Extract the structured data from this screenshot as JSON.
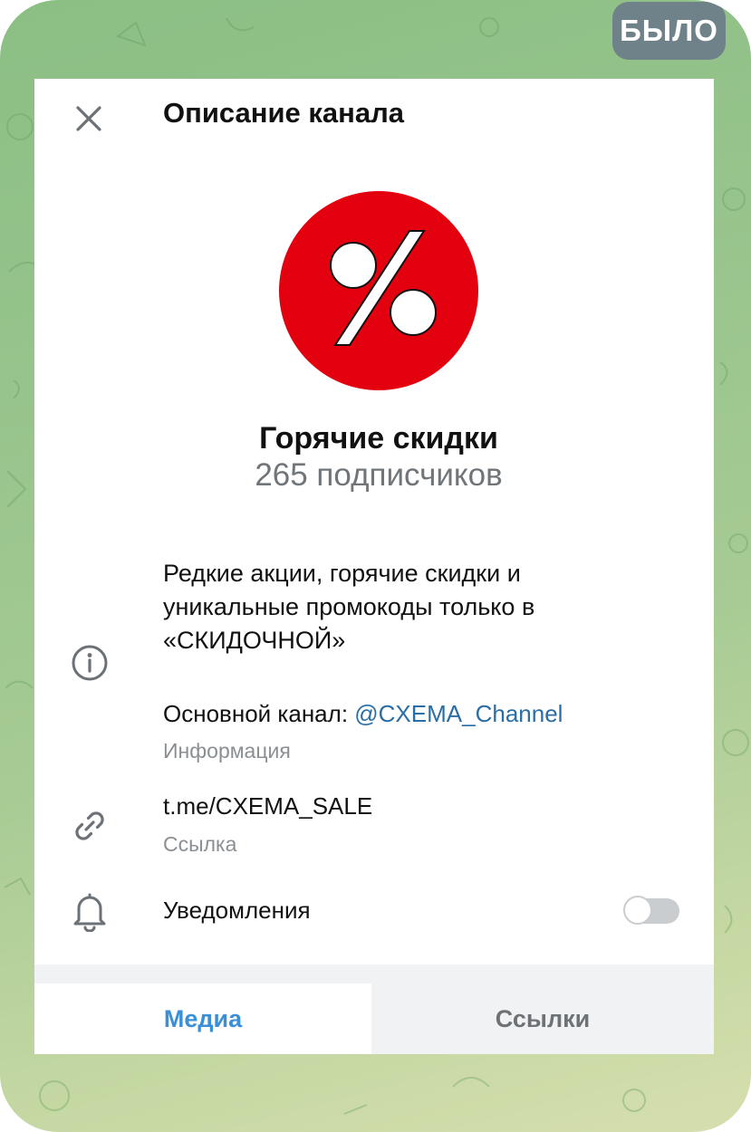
{
  "badge": "БЫЛО",
  "header": {
    "title": "Описание канала",
    "close_icon": "close-icon"
  },
  "channel": {
    "avatar_color": "#e3000f",
    "avatar_icon": "percent-icon",
    "name": "Горячие скидки",
    "subscribers": "265 подписчиков"
  },
  "info": {
    "icon": "info-icon",
    "description_lines": [
      "Редкие акции, горячие скидки и",
      "уникальные промокоды только в",
      "«СКИДОЧНОЙ»"
    ],
    "main_channel_prefix": "Основной канал: ",
    "main_channel_mention": "@CXEMA_Channel",
    "label": "Информация"
  },
  "link": {
    "icon": "link-icon",
    "value": "t.me/CXEMA_SALE",
    "label": "Ссылка"
  },
  "notifications": {
    "icon": "bell-icon",
    "label": "Уведомления",
    "enabled": false
  },
  "tabs": [
    {
      "label": "Медиа",
      "active": true
    },
    {
      "label": "Ссылки",
      "active": false
    }
  ],
  "colors": {
    "accent": "#3a8fd9",
    "mention": "#2a6ea5",
    "avatar": "#e3000f",
    "badge": "#6f8189"
  }
}
